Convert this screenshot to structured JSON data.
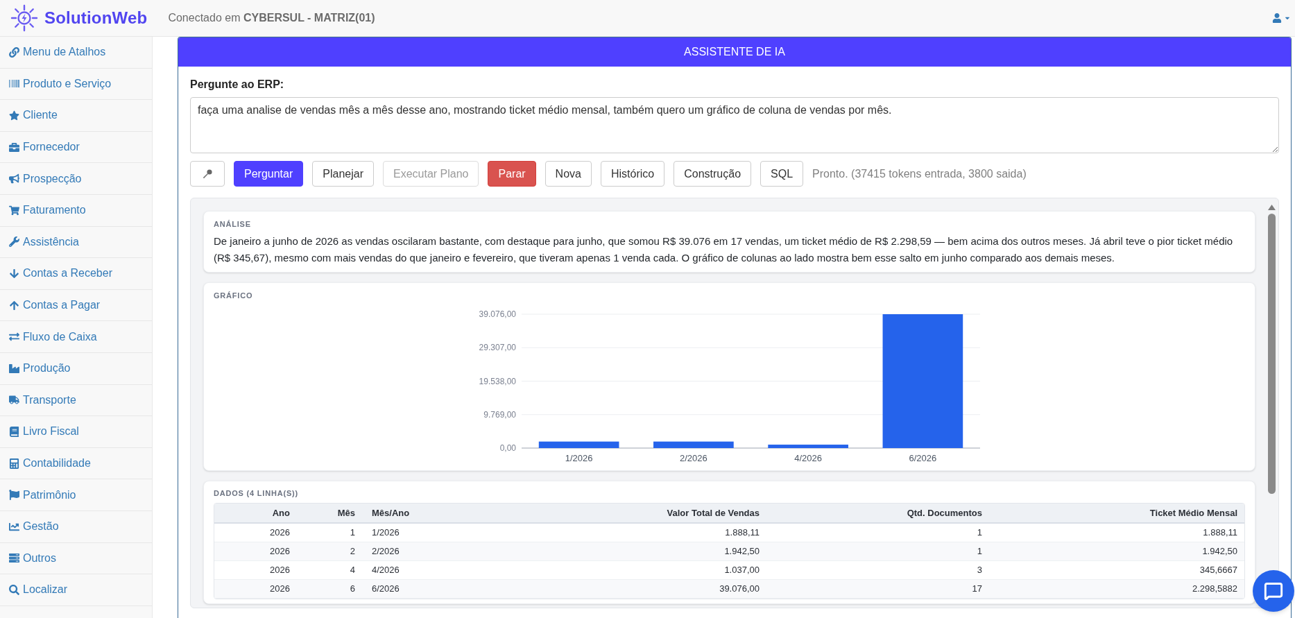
{
  "header": {
    "brand": "SolutionWeb",
    "connection": "Conectado em **CYBERSUL - MATRIZ(01)**"
  },
  "sidebar": {
    "items": [
      {
        "label": "Menu de Atalhos"
      },
      {
        "label": "Produto e Serviço"
      },
      {
        "label": "Cliente"
      },
      {
        "label": "Fornecedor"
      },
      {
        "label": "Prospecção"
      },
      {
        "label": "Faturamento"
      },
      {
        "label": "Assistência"
      },
      {
        "label": "Contas a Receber"
      },
      {
        "label": "Contas a Pagar"
      },
      {
        "label": "Fluxo de Caixa"
      },
      {
        "label": "Produção"
      },
      {
        "label": "Transporte"
      },
      {
        "label": "Livro Fiscal"
      },
      {
        "label": "Contabilidade"
      },
      {
        "label": "Patrimônio"
      },
      {
        "label": "Gestão"
      },
      {
        "label": "Outros"
      },
      {
        "label": "Localizar"
      }
    ]
  },
  "assistant": {
    "title": "ASSISTENTE DE IA",
    "prompt_label": "Pergunte ao ERP:",
    "question": "faça uma analise de vendas mês a mês desse ano, mostrando ticket médio mensal, também quero um gráfico de coluna de vendas por mês.",
    "buttons": [
      {
        "kind": "icon",
        "disabled": false
      },
      {
        "kind": "primary",
        "label": "Perguntar",
        "disabled": false
      },
      {
        "kind": "default",
        "label": "Planejar",
        "disabled": false
      },
      {
        "kind": "default",
        "label": "Executar Plano",
        "disabled": true
      },
      {
        "kind": "danger",
        "label": "Parar",
        "disabled": false
      },
      {
        "kind": "default",
        "label": "Nova",
        "disabled": false
      },
      {
        "kind": "default",
        "label": "Histórico",
        "disabled": false
      },
      {
        "kind": "default",
        "label": "Construção",
        "disabled": false
      },
      {
        "kind": "default",
        "label": "SQL",
        "disabled": false
      }
    ],
    "status": "Pronto. (37415 tokens entrada, 3800 saida)"
  },
  "analysis": {
    "title": "ANÁLISE",
    "text": "De janeiro a junho de 2026 as vendas oscilaram bastante, com destaque para junho, que somou R$ 39.076 em 17 vendas, um ticket médio de R$ 2.298,59 — bem acima dos outros meses. Já abril teve o pior ticket médio (R$ 345,67), mesmo com mais vendas do que janeiro e fevereiro, que tiveram apenas 1 venda cada. O gráfico de colunas ao lado mostra bem esse salto em junho comparado aos demais meses."
  },
  "chart": {
    "title": "GRÁFICO",
    "chart_data": {
      "type": "bar",
      "categories": [
        "1/2026",
        "2/2026",
        "4/2026",
        "6/2026"
      ],
      "values": [
        1900,
        1900,
        1000,
        39076
      ],
      "ylim": [
        0,
        39076
      ],
      "yticks": [
        {
          "value": 0,
          "label": "0,00"
        },
        {
          "value": 9769,
          "label": "9.769,00"
        },
        {
          "value": 19538,
          "label": "19.538,00"
        },
        {
          "value": 29307,
          "label": "29.307,00"
        },
        {
          "value": 39076,
          "label": "39.076,00"
        }
      ],
      "grid": true
    }
  },
  "data": {
    "title": "DADOS (4 LINHA(S))",
    "columns": [
      "Ano",
      "Mês",
      "Mês/Ano",
      "Valor Total de Vendas",
      "Qtd. Documentos",
      "Ticket Médio Mensal"
    ],
    "rows": [
      [
        "2026",
        "1",
        "1/2026",
        "1.888,11",
        "1",
        "1.888,11"
      ],
      [
        "2026",
        "2",
        "2/2026",
        "1.942,50",
        "1",
        "1.942,50"
      ],
      [
        "2026",
        "4",
        "4/2026",
        "1.037,00",
        "3",
        "345,6667"
      ],
      [
        "2026",
        "6",
        "6/2026",
        "39.076,00",
        "17",
        "2.298,5882"
      ]
    ]
  }
}
